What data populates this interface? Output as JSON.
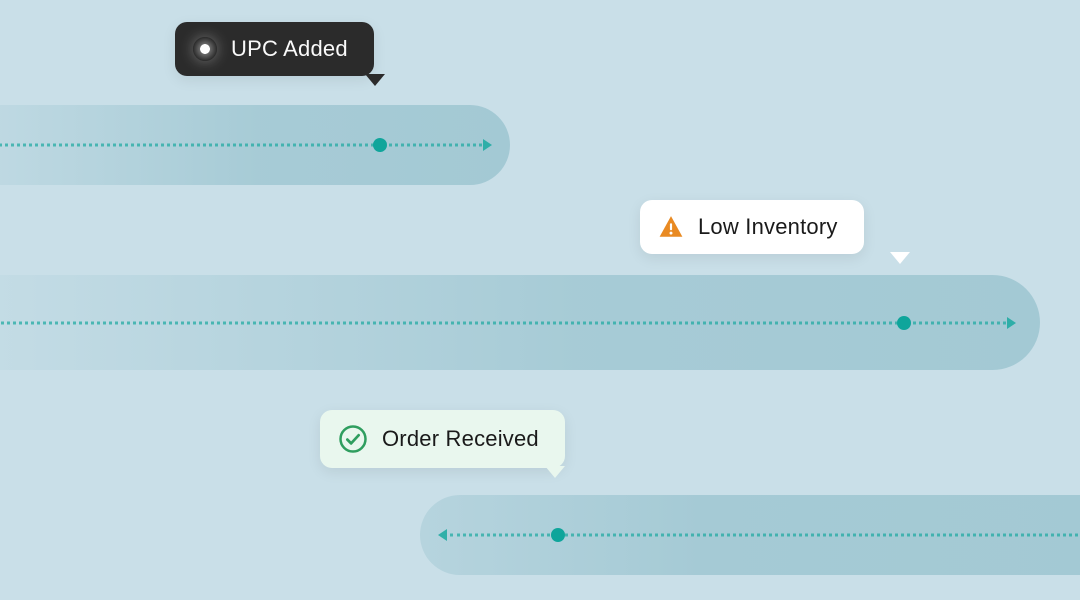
{
  "tags": {
    "upc": {
      "label": "UPC Added",
      "icon": "record-icon",
      "style": "dark"
    },
    "inventory": {
      "label": "Low Inventory",
      "icon": "warning-icon",
      "style": "white"
    },
    "order": {
      "label": "Order Received",
      "icon": "check-circle-icon",
      "style": "pale-green"
    }
  },
  "colors": {
    "background": "#c9dfe8",
    "track": "#a3c9d4",
    "accent": "#0fa59b",
    "dark": "#2b2b2b",
    "warning": "#e98a22",
    "success": "#2f9e5f",
    "paleGreen": "#e9f7ee"
  }
}
